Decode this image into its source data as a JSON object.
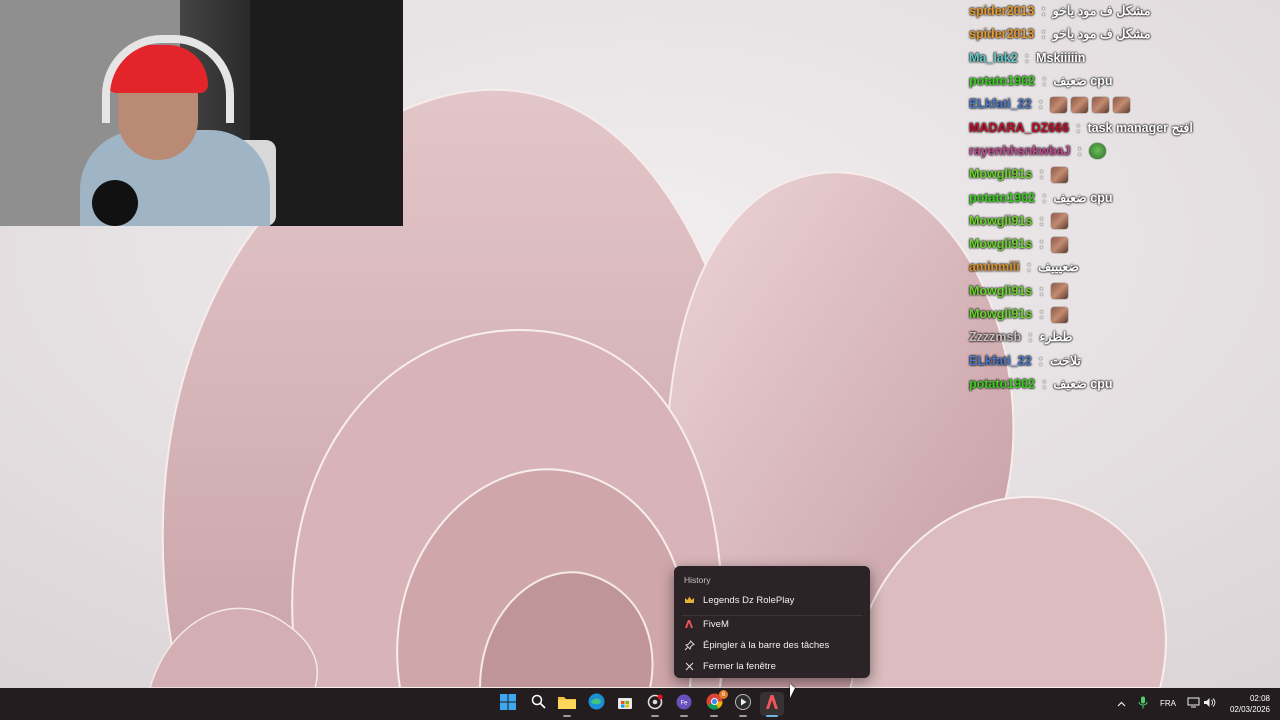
{
  "desktop": {
    "wallpaper": "windows-11-bloom-pink"
  },
  "webcam": {
    "description_icon": "webcam-overlay"
  },
  "chat": {
    "messages": [
      {
        "user": "spider2013",
        "color": "#e89b2f",
        "sep": " : ",
        "text": "مشكل ف مود ياخو",
        "emotes": []
      },
      {
        "user": "spider2013",
        "color": "#e89b2f",
        "sep": " : ",
        "text": "مشكل ف مود ياخو",
        "emotes": []
      },
      {
        "user": "Ma_lak2",
        "color": "#5fc9c9",
        "sep": " : ",
        "text": "Mskiiiiin",
        "emotes": []
      },
      {
        "user": "potato1902",
        "color": "#39d11e",
        "sep": " : ",
        "text": "ضعيف cpu",
        "emotes": []
      },
      {
        "user": "ELkfati_22",
        "color": "#4a78c7",
        "sep": " : ",
        "text": "",
        "emotes": [
          "face",
          "face",
          "face",
          "face"
        ]
      },
      {
        "user": "MADARA_DZ666",
        "color": "#c0102a",
        "sep": " : ",
        "text": "task manager افتح",
        "emotes": []
      },
      {
        "user": "rayenhhsnkwbaJ",
        "color": "#c24a8f",
        "sep": " : ",
        "text": "",
        "emotes": [
          "frog"
        ]
      },
      {
        "user": "Mowgli91s",
        "color": "#6bd62a",
        "sep": " : ",
        "text": "",
        "emotes": [
          "face"
        ]
      },
      {
        "user": "potato1902",
        "color": "#39d11e",
        "sep": " : ",
        "text": "ضعيف cpu",
        "emotes": []
      },
      {
        "user": "Mowgli91s",
        "color": "#6bd62a",
        "sep": " : ",
        "text": "",
        "emotes": [
          "face"
        ]
      },
      {
        "user": "Mowgli91s",
        "color": "#6bd62a",
        "sep": " : ",
        "text": "",
        "emotes": [
          "face"
        ]
      },
      {
        "user": "aminmili",
        "color": "#d9902a",
        "sep": " : ",
        "text": "ضعيييف",
        "emotes": []
      },
      {
        "user": "Mowgli91s",
        "color": "#6bd62a",
        "sep": " : ",
        "text": "",
        "emotes": [
          "face"
        ]
      },
      {
        "user": "Mowgli91s",
        "color": "#6bd62a",
        "sep": " : ",
        "text": "",
        "emotes": [
          "face"
        ]
      },
      {
        "user": "Zzzzmsb",
        "color": "#c9bcbc",
        "sep": " : ",
        "text": "طظرء",
        "emotes": []
      },
      {
        "user": "ELkfati_22",
        "color": "#4a78c7",
        "sep": " : ",
        "text": "تلاخت",
        "emotes": []
      },
      {
        "user": "potato1902",
        "color": "#39d11e",
        "sep": " : ",
        "text": "ضعيف cpu",
        "emotes": []
      }
    ]
  },
  "context_menu": {
    "header": "History",
    "items": [
      {
        "label": "Legends Dz RolePlay",
        "icon": "crown-icon"
      },
      {
        "label": "FiveM",
        "icon": "fivem-icon"
      },
      {
        "label": "Épingler à la barre des tâches",
        "icon": "pin-icon"
      },
      {
        "label": "Fermer la fenêtre",
        "icon": "close-icon"
      }
    ]
  },
  "taskbar": {
    "apps": [
      {
        "name": "start",
        "icon": "windows-start-icon"
      },
      {
        "name": "search",
        "icon": "search-icon"
      },
      {
        "name": "file-explorer",
        "icon": "folder-icon"
      },
      {
        "name": "edge",
        "icon": "edge-icon"
      },
      {
        "name": "store",
        "icon": "store-icon"
      },
      {
        "name": "app-gear",
        "icon": "settings-app-icon"
      },
      {
        "name": "streamlabs",
        "icon": "streaming-app-icon"
      },
      {
        "name": "chrome",
        "icon": "chrome-icon",
        "badge": "6"
      },
      {
        "name": "media-player",
        "icon": "play-icon"
      },
      {
        "name": "fivem",
        "icon": "fivem-icon"
      }
    ],
    "tray": {
      "language": "FRA",
      "time": "02:08",
      "date": "02/03/2026"
    }
  }
}
